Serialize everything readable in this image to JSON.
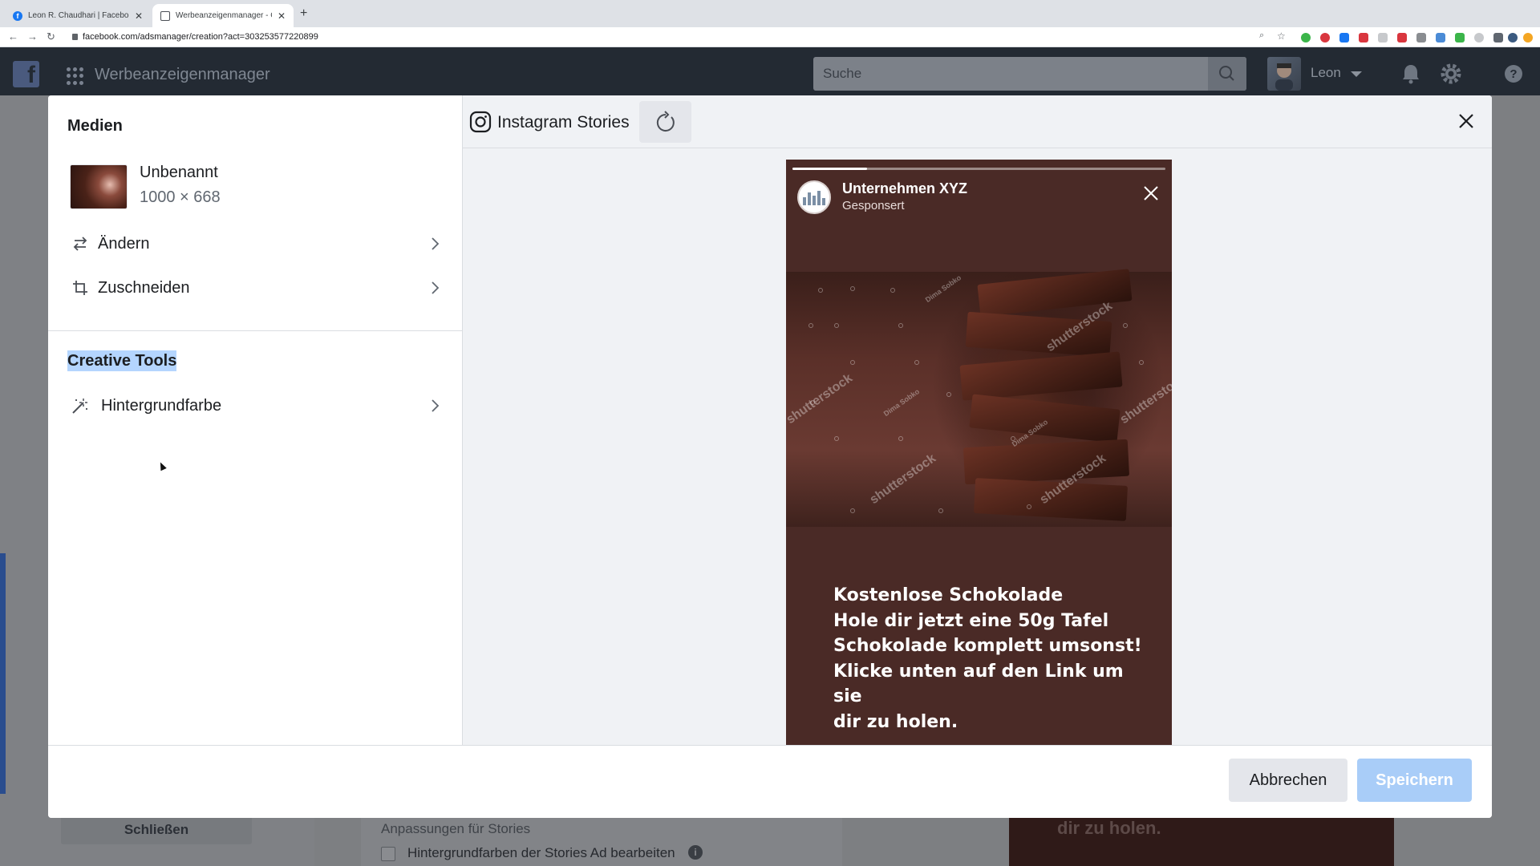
{
  "browser": {
    "tabs": [
      {
        "title": "Leon R. Chaudhari | Facebook",
        "active": false
      },
      {
        "title": "Werbeanzeigenmanager - Cre",
        "active": true
      }
    ],
    "new_tab_label": "+",
    "url": "facebook.com/adsmanager/creation?act=303253577220899"
  },
  "fb_nav": {
    "app_title": "Werbeanzeigenmanager",
    "search_placeholder": "Suche",
    "user_name": "Leon"
  },
  "background_page": {
    "close_button": "Schließen",
    "section_title": "Anpassungen für Stories",
    "checkbox_label": "Hintergrundfarben der Stories Ad bearbeiten",
    "info_icon": "i",
    "story_text": "dir zu holen."
  },
  "media_panel": {
    "title": "Medien",
    "media_name": "Unbenannt",
    "media_size": "1000 × 668",
    "actions": [
      {
        "label": "Ändern",
        "icon": "swap-icon"
      },
      {
        "label": "Zuschneiden",
        "icon": "crop-icon"
      }
    ],
    "creative_tools_title": "Creative Tools",
    "creative_tools": [
      {
        "label": "Hintergrundfarbe",
        "icon": "magic-wand-icon"
      }
    ]
  },
  "preview": {
    "placement": "Instagram Stories",
    "story": {
      "brand": "Unternehmen XYZ",
      "sponsored": "Gesponsert",
      "progress": 0.2,
      "watermarks": [
        "shutterstock",
        "Dima Sobko"
      ],
      "text_lines": [
        "Kostenlose Schokolade",
        "Hole dir jetzt eine 50g Tafel",
        "Schokolade komplett umsonst!",
        "Klicke unten auf den Link um sie",
        "dir zu holen."
      ]
    }
  },
  "footer": {
    "cancel_label": "Abbrechen",
    "save_label": "Speichern"
  },
  "colors": {
    "fb_nav": "#232a33",
    "save_disabled": "#a9cdf8",
    "highlight": "#b4d5fe",
    "story_bg": "#4a2a26"
  }
}
